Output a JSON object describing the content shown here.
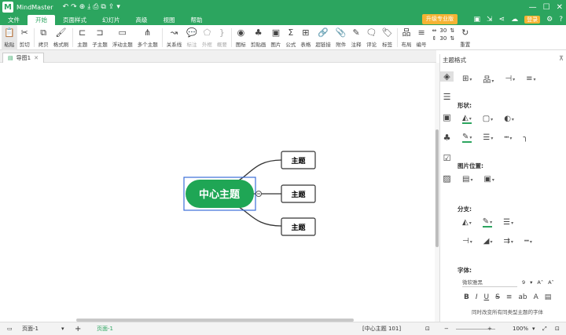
{
  "app": {
    "name": "MindMaster",
    "logo_text": "M"
  },
  "quick_access": [
    "↶",
    "↷",
    "⊕",
    "⤓",
    "⎙",
    "⧉",
    "⇪",
    "▾"
  ],
  "menu": [
    "文件",
    "开始",
    "页面样式",
    "幻灯片",
    "高级",
    "视图",
    "帮助"
  ],
  "active_menu": "开始",
  "upgrade_label": "升级专业版",
  "login_label": "登录",
  "toolbar": [
    {
      "label": "粘贴",
      "icon": "📋",
      "name": "paste"
    },
    {
      "label": "剪切",
      "icon": "✂",
      "name": "cut"
    },
    {
      "label": "拷贝",
      "icon": "⧉",
      "name": "copy"
    },
    {
      "label": "格式刷",
      "icon": "🖌",
      "name": "format-painter"
    },
    {
      "label": "主题",
      "icon": "⊏",
      "name": "topic"
    },
    {
      "label": "子主题",
      "icon": "⊐",
      "name": "subtopic"
    },
    {
      "label": "浮动主题",
      "icon": "▭",
      "name": "floating-topic"
    },
    {
      "label": "多个主题",
      "icon": "⋔",
      "name": "multiple-topics"
    },
    {
      "label": "关系线",
      "icon": "↝",
      "name": "relationship"
    },
    {
      "label": "标注",
      "icon": "💬",
      "name": "callout"
    },
    {
      "label": "外框",
      "icon": "⬠",
      "name": "boundary"
    },
    {
      "label": "概要",
      "icon": "}",
      "name": "summary"
    },
    {
      "label": "图标",
      "icon": "◉",
      "name": "icon"
    },
    {
      "label": "剪贴画",
      "icon": "♣",
      "name": "clipart"
    },
    {
      "label": "图片",
      "icon": "▣",
      "name": "picture"
    },
    {
      "label": "公式",
      "icon": "Σ",
      "name": "formula"
    },
    {
      "label": "表格",
      "icon": "⊞",
      "name": "table"
    },
    {
      "label": "超链接",
      "icon": "🔗",
      "name": "hyperlink"
    },
    {
      "label": "附件",
      "icon": "📎",
      "name": "attachment"
    },
    {
      "label": "注释",
      "icon": "✎",
      "name": "note"
    },
    {
      "label": "评论",
      "icon": "🗨",
      "name": "comment"
    },
    {
      "label": "标签",
      "icon": "🏷",
      "name": "tag"
    },
    {
      "label": "布局",
      "icon": "品",
      "name": "layout"
    },
    {
      "label": "编号",
      "icon": "≡",
      "name": "numbering"
    },
    {
      "label": "重置",
      "icon": "↻",
      "name": "reset"
    }
  ],
  "spinners": {
    "a": "30",
    "b": "30"
  },
  "doc_tab": "导图1",
  "mindmap": {
    "central": "中心主题",
    "topics": [
      "主题",
      "主题",
      "主题"
    ]
  },
  "panel": {
    "title": "主题格式",
    "shape_label": "形状:",
    "image_pos_label": "图片位置:",
    "branch_label": "分支:",
    "font_label": "字体:",
    "font_name": "微软雅黑",
    "font_size": "9",
    "hint": "同时改变所有同类型主题的字体"
  },
  "status": {
    "page": "页面-1",
    "page_tab": "页面-1",
    "selection": "[中心主题 101]",
    "zoom": "100%"
  },
  "colors": {
    "brand": "#2ca55f",
    "upgrade": "#f5b333",
    "selection": "#3b6fd8"
  }
}
